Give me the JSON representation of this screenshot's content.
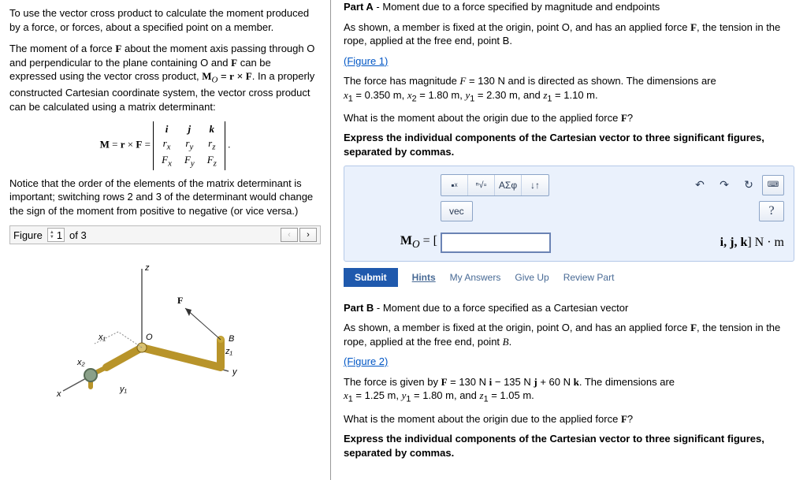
{
  "left": {
    "p1": "To use the vector cross product to calculate the moment produced by a force, or forces, about a specified point on a member.",
    "p2_a": "The moment of a force ",
    "p2_b": " about the moment axis passing through O and perpendicular to the plane containing O and ",
    "p2_c": " can be expressed using the vector cross product, ",
    "p2_d": ". In a properly constructed Cartesian coordinate system, the vector cross product can be calculated using a matrix determinant:",
    "mo_eq": "M",
    "mo_sub": "O",
    "mo_rxF": " = r × F",
    "det_prefix": "M = r × F = ",
    "p3": "Notice that the order of the elements of the matrix determinant is important; switching rows 2 and 3 of the determinant would change the sign of the moment from positive to negative (or vice versa.)",
    "fig_label": "Figure",
    "fig_value": "1",
    "fig_of": "of 3"
  },
  "partA": {
    "head_part": "Part A",
    "head_title": " - Moment due to a force specified by magnitude and endpoints",
    "p1": "As shown, a member is fixed at the origin, point O, and has an applied force F, the tension in the rope, applied at the free end, point B.",
    "fig_link": "(Figure 1)",
    "p2a": "The force has magnitude ",
    "p2_force": "F = 130 N",
    "p2b": " and is directed as shown. The dimensions are ",
    "p2_dims": "x₁ = 0.350 m, x₂ = 1.80 m, y₁ = 2.30 m, and z₁ = 1.10 m.",
    "q": "What is the moment about the origin due to the applied force F?",
    "instr": "Express the individual components of the Cartesian vector to three significant figures, separated by commas.",
    "eq_prefix": "M",
    "eq_sub": "O",
    "eq_eq": " = [",
    "eq_suffix": "i, j, k] N · m",
    "vec_label": "vec",
    "symbtn": "ΑΣφ",
    "submit": "Submit",
    "hints": "Hints",
    "myans": "My Answers",
    "giveup": "Give Up",
    "review": "Review Part"
  },
  "partB": {
    "head_part": "Part B",
    "head_title": " - Moment due to a force specified as a Cartesian vector",
    "p1": "As shown, a member is fixed at the origin, point O, and has an applied force F, the tension in the rope, applied at the free end, point B.",
    "fig_link": "(Figure 2)",
    "p2a": "The force is given by ",
    "p2_force": "F = 130 N i − 135 N j + 60 N k",
    "p2b": ". The dimensions are ",
    "p2_dims": "x₁ = 1.25 m, y₁ = 1.80 m, and z₁ = 1.05 m.",
    "q": "What is the moment about the origin due to the applied force F?",
    "instr": "Express the individual components of the Cartesian vector to three significant figures, separated by commas."
  }
}
